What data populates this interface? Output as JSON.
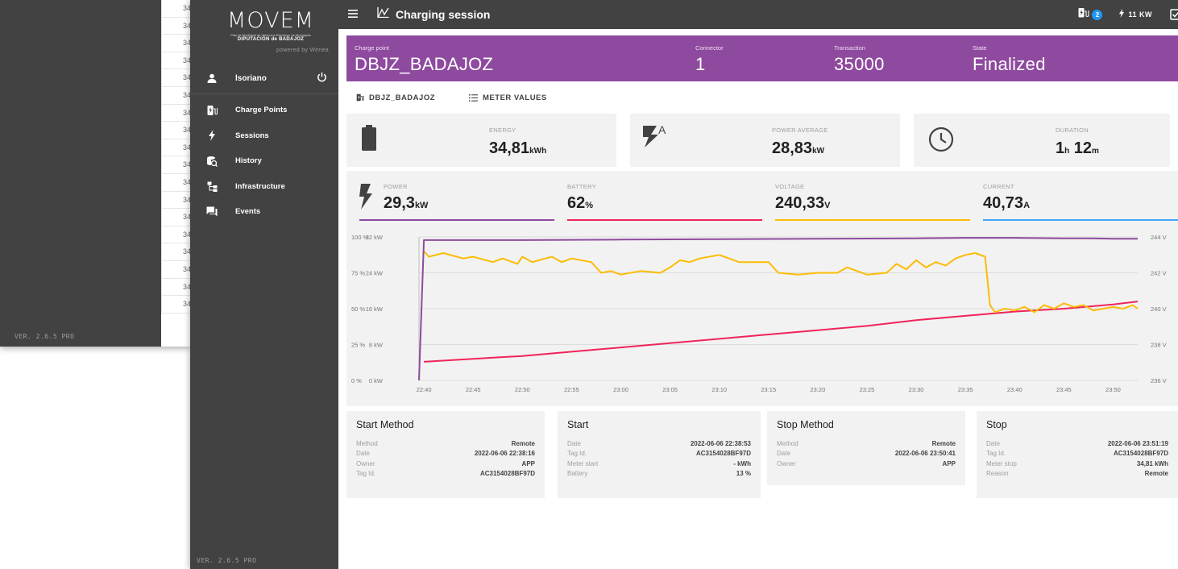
{
  "background_window": {
    "version": "VER. 2.6.5 PRO",
    "row_prefixes": [
      "34",
      "34",
      "34",
      "34",
      "34",
      "34",
      "34",
      "34",
      "34",
      "34",
      "34",
      "34",
      "34",
      "34",
      "34",
      "34",
      "34",
      "34"
    ]
  },
  "sidebar": {
    "logo_word": "MOVEM",
    "logo_subtitle": "Plan de Movilidad de Vehículos Eléctricos de Municipios",
    "logo_org": "DIPUTACIÓN de BADAJOZ",
    "powered_by": "powered by Wenea",
    "user": "lsoriano",
    "items": [
      {
        "label": "Charge Points",
        "icon": "charge-point-icon"
      },
      {
        "label": "Sessions",
        "icon": "bolt-icon"
      },
      {
        "label": "History",
        "icon": "history-icon"
      },
      {
        "label": "Infrastructure",
        "icon": "infrastructure-icon"
      },
      {
        "label": "Events",
        "icon": "events-icon"
      }
    ],
    "version": "VER. 2.6.5 PRO"
  },
  "topbar": {
    "title": "Charging session",
    "charge_badge": "2",
    "power": "11 KW"
  },
  "session": {
    "charge_point_label": "Charge point",
    "charge_point": "DBJZ_BADAJOZ",
    "connector_label": "Connector",
    "connector": "1",
    "transaction_label": "Transaction",
    "transaction": "35000",
    "state_label": "State",
    "state": "Finalized"
  },
  "tabs": {
    "charge_point": "DBJZ_BADAJOZ",
    "meter_values": "METER VALUES"
  },
  "stats": {
    "energy_label": "ENERGY",
    "energy_value": "34,81",
    "energy_unit": "kWh",
    "power_avg_label": "POWER AVERAGE",
    "power_avg_value": "28,83",
    "power_avg_unit": "kW",
    "duration_label": "DURATION",
    "duration_h": "1",
    "duration_h_unit": "h",
    "duration_m": "12",
    "duration_m_unit": "m"
  },
  "meters": {
    "power_label": "POWER",
    "power_value": "29,3",
    "power_unit": "kW",
    "battery_label": "BATTERY",
    "battery_value": "62",
    "battery_unit": "%",
    "voltage_label": "VOLTAGE",
    "voltage_value": "240,33",
    "voltage_unit": "V",
    "current_label": "CURRENT",
    "current_value": "40,73",
    "current_unit": "A"
  },
  "colors": {
    "power": "#8e4a9e",
    "battery": "#f0245a",
    "voltage": "#fbbc05",
    "current": "#42a5f5",
    "header": "#8e4a9e"
  },
  "chart_data": {
    "type": "line",
    "x": [
      "22:40",
      "22:45",
      "22:50",
      "22:55",
      "23:00",
      "23:05",
      "23:10",
      "23:15",
      "23:20",
      "23:25",
      "23:30",
      "23:35",
      "23:40",
      "23:45",
      "23:50"
    ],
    "y_left_pct_ticks": [
      "100 %",
      "75 %",
      "50 %",
      "25 %",
      "0 %"
    ],
    "y_left_kw_ticks": [
      "32 kW",
      "24 kW",
      "16 kW",
      "8 kW",
      "0 kW"
    ],
    "y_right_v_ticks": [
      "244 V",
      "242 V",
      "240 V",
      "238 V",
      "236 V"
    ],
    "ylim_kw": [
      0,
      32
    ],
    "ylim_pct": [
      0,
      100
    ],
    "ylim_v": [
      236,
      244
    ],
    "grid": true,
    "series": [
      {
        "name": "POWER",
        "axis": "kw",
        "points": [
          [
            "22:39.5",
            0
          ],
          [
            "22:40",
            31.3
          ],
          [
            "22:41",
            31.3
          ],
          [
            "22:50",
            31.3
          ],
          [
            "23:00",
            31.4
          ],
          [
            "23:10",
            31.5
          ],
          [
            "23:20",
            31.6
          ],
          [
            "23:30",
            31.7
          ],
          [
            "23:35",
            31.8
          ],
          [
            "23:40",
            31.8
          ],
          [
            "23:45",
            31.7
          ],
          [
            "23:48",
            31.7
          ],
          [
            "23:50",
            31.6
          ],
          [
            "23:52.5",
            31.6
          ]
        ]
      },
      {
        "name": "BATTERY",
        "axis": "pct",
        "points": [
          [
            "22:40",
            13
          ],
          [
            "22:45",
            15
          ],
          [
            "22:50",
            17
          ],
          [
            "22:55",
            20
          ],
          [
            "23:00",
            23
          ],
          [
            "23:05",
            26
          ],
          [
            "23:10",
            29
          ],
          [
            "23:15",
            32
          ],
          [
            "23:20",
            35
          ],
          [
            "23:25",
            38
          ],
          [
            "23:30",
            42
          ],
          [
            "23:35",
            45
          ],
          [
            "23:40",
            48
          ],
          [
            "23:45",
            50
          ],
          [
            "23:50",
            53
          ],
          [
            "23:52.5",
            55
          ]
        ]
      },
      {
        "name": "VOLTAGE",
        "axis": "v",
        "points": [
          [
            "22:40",
            243.2
          ],
          [
            "22:40.5",
            242.9
          ],
          [
            "22:42",
            243.1
          ],
          [
            "22:44",
            242.8
          ],
          [
            "22:45",
            242.9
          ],
          [
            "22:47",
            242.6
          ],
          [
            "22:48",
            242.8
          ],
          [
            "22:49.5",
            242.5
          ],
          [
            "22:50",
            242.9
          ],
          [
            "22:51",
            242.6
          ],
          [
            "22:53",
            242.9
          ],
          [
            "22:54",
            242.6
          ],
          [
            "22:55",
            242.8
          ],
          [
            "22:57",
            242.6
          ],
          [
            "22:58",
            242.0
          ],
          [
            "22:59",
            242.1
          ],
          [
            "23:00",
            241.9
          ],
          [
            "23:02",
            242.1
          ],
          [
            "23:04",
            242.0
          ],
          [
            "23:05",
            242.3
          ],
          [
            "23:06",
            242.7
          ],
          [
            "23:07",
            242.6
          ],
          [
            "23:08",
            242.8
          ],
          [
            "23:10",
            243.0
          ],
          [
            "23:11",
            242.8
          ],
          [
            "23:12",
            242.6
          ],
          [
            "23:14",
            242.6
          ],
          [
            "23:15",
            242.6
          ],
          [
            "23:16",
            242.0
          ],
          [
            "23:18",
            241.9
          ],
          [
            "23:20",
            242.0
          ],
          [
            "23:22",
            242.0
          ],
          [
            "23:23",
            242.3
          ],
          [
            "23:24",
            242.1
          ],
          [
            "23:25",
            241.9
          ],
          [
            "23:27",
            242.0
          ],
          [
            "23:28",
            242.5
          ],
          [
            "23:29",
            242.2
          ],
          [
            "23:30",
            242.7
          ],
          [
            "23:31",
            242.3
          ],
          [
            "23:32",
            242.6
          ],
          [
            "23:33",
            242.4
          ],
          [
            "23:34",
            242.8
          ],
          [
            "23:35",
            243.0
          ],
          [
            "23:36",
            243.1
          ],
          [
            "23:37",
            242.9
          ],
          [
            "23:37.5",
            240.2
          ],
          [
            "23:38",
            239.8
          ],
          [
            "23:39",
            240.0
          ],
          [
            "23:40",
            239.9
          ],
          [
            "23:41",
            240.1
          ],
          [
            "23:42",
            239.8
          ],
          [
            "23:43",
            240.2
          ],
          [
            "23:44",
            240.0
          ],
          [
            "23:45",
            240.3
          ],
          [
            "23:46",
            240.1
          ],
          [
            "23:47",
            240.2
          ],
          [
            "23:48",
            239.9
          ],
          [
            "23:49",
            240.0
          ],
          [
            "23:50",
            240.1
          ],
          [
            "23:51",
            240.0
          ],
          [
            "23:52",
            240.2
          ],
          [
            "23:52.5",
            240.0
          ]
        ]
      }
    ]
  },
  "details": [
    {
      "title": "Start Method",
      "rows": [
        [
          "Method",
          "Remote"
        ],
        [
          "Date",
          "2022-06-06 22:38:16"
        ],
        [
          "Owner",
          "APP"
        ],
        [
          "Tag Id.",
          "AC3154028BF97D"
        ]
      ]
    },
    {
      "title": "Start",
      "rows": [
        [
          "Date",
          "2022-06-06 22:38:53"
        ],
        [
          "Tag Id.",
          "AC3154028BF97D"
        ],
        [
          "Meter start",
          "- kWh"
        ],
        [
          "Battery",
          "13 %"
        ]
      ]
    },
    {
      "title": "Stop Method",
      "rows": [
        [
          "Method",
          "Remote"
        ],
        [
          "Date",
          "2022-06-06 23:50:41"
        ],
        [
          "Owner",
          "APP"
        ]
      ]
    },
    {
      "title": "Stop",
      "rows": [
        [
          "Date",
          "2022-06-06 23:51:19"
        ],
        [
          "Tag Id.",
          "AC3154028BF97D"
        ],
        [
          "Meter stop",
          "34,81 kWh"
        ],
        [
          "Reason",
          "Remote"
        ]
      ]
    }
  ]
}
